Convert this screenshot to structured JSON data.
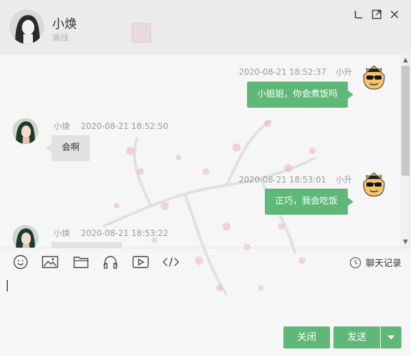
{
  "header": {
    "name": "小焕",
    "status": "离线"
  },
  "window_controls": [
    "minimize-icon",
    "maximize-icon",
    "close-icon"
  ],
  "messages": [
    {
      "side": "me",
      "sender": "小升",
      "time": "2020-08-21 18:52:37",
      "text": "小姐姐，你会煮饭吗"
    },
    {
      "side": "other",
      "sender": "小焕",
      "time": "2020-08-21 18:52:50",
      "text": "会啊"
    },
    {
      "side": "me",
      "sender": "小升",
      "time": "2020-08-21 18:53:01",
      "text": "正巧，我会吃饭"
    },
    {
      "side": "other",
      "sender": "小焕",
      "time": "2020-08-21 18:53:22",
      "text": ""
    }
  ],
  "toolbar": {
    "tools": [
      "emoji-icon",
      "image-icon",
      "folder-icon",
      "headphones-icon",
      "video-icon",
      "code-icon"
    ],
    "history_label": "聊天记录"
  },
  "input": {
    "value": ""
  },
  "buttons": {
    "close_label": "关闭",
    "send_label": "发送"
  },
  "colors": {
    "accent": "#5fb878",
    "other_bubble": "#e2e2e2",
    "header_bg": "#ebebeb"
  }
}
